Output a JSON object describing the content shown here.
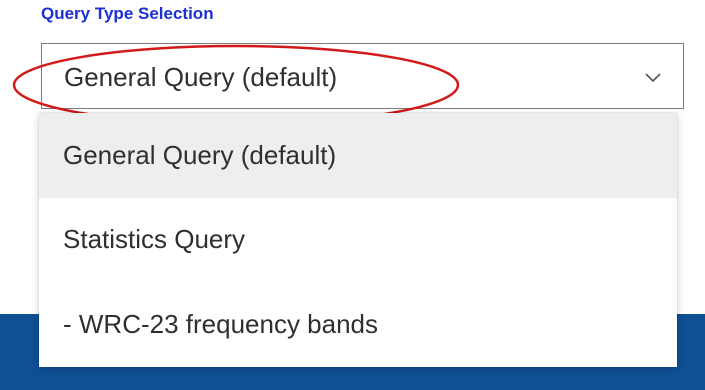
{
  "section": {
    "title": "Query Type Selection"
  },
  "select": {
    "value": "General Query (default)",
    "options": [
      "General Query (default)",
      "Statistics Query",
      "- WRC-23 frequency bands"
    ]
  },
  "colors": {
    "title": "#1f2fd6",
    "annotation_ellipse": "#d31a1a",
    "banner": "#0f4f95",
    "selected_option_bg": "#eeeeee"
  }
}
